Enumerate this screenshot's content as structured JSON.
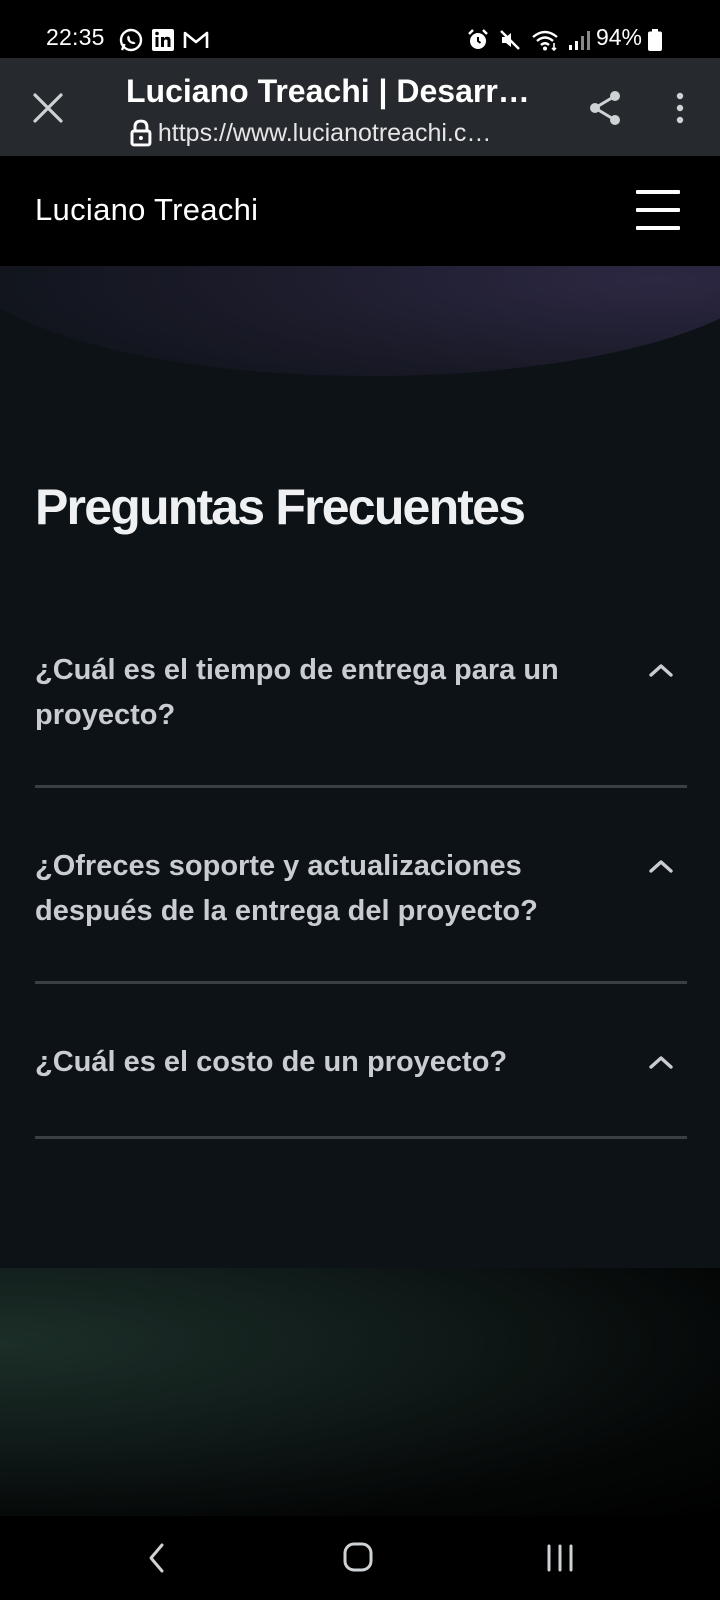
{
  "status_bar": {
    "time": "22:35",
    "battery_percent": "94%",
    "left_icons": [
      "whatsapp-icon",
      "linkedin-icon",
      "gmail-icon"
    ],
    "right_icons": [
      "alarm-icon",
      "mute-icon",
      "wifi-icon",
      "signal-icon",
      "battery-icon"
    ]
  },
  "browser": {
    "page_title": "Luciano Treachi | Desarr…",
    "url": "https://www.lucianotreachi.c…"
  },
  "site_header": {
    "logo_text": "Luciano Treachi"
  },
  "faq": {
    "title": "Preguntas Frecuentes",
    "items": [
      {
        "question": "¿Cuál es el tiempo de entrega para un proyecto?",
        "expanded": true
      },
      {
        "question": "¿Ofreces soporte y actualizaciones después de la entrega del proyecto?",
        "expanded": true
      },
      {
        "question": "¿Cuál es el costo de un proyecto?",
        "expanded": true
      }
    ]
  },
  "colors": {
    "page_bg": "#0c1216",
    "toolbar_bg": "#26292d",
    "divider": "#3a3f44",
    "question_text": "#c9cdd1"
  }
}
